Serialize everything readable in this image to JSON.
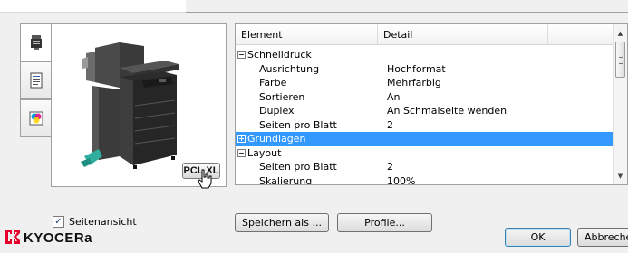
{
  "tabs": [
    {
      "name": "printer-tab",
      "icon": "printer-icon",
      "active": true
    },
    {
      "name": "document-tab",
      "icon": "document-icon",
      "active": false
    },
    {
      "name": "color-tab",
      "icon": "color-quality-icon",
      "active": false
    }
  ],
  "preview": {
    "pdl_badge": "PCL XL",
    "show_preview_label": "Seitenansicht",
    "show_preview_checked": true
  },
  "table": {
    "headers": [
      "Element",
      "Detail",
      ""
    ],
    "rows": [
      {
        "label": "Schnelldruck",
        "value": "",
        "level": 0,
        "toggle": "minus",
        "selected": false
      },
      {
        "label": "Ausrichtung",
        "value": "Hochformat",
        "level": 1,
        "toggle": "",
        "selected": false
      },
      {
        "label": "Farbe",
        "value": "Mehrfarbig",
        "level": 1,
        "toggle": "",
        "selected": false
      },
      {
        "label": "Sortieren",
        "value": "An",
        "level": 1,
        "toggle": "",
        "selected": false
      },
      {
        "label": "Duplex",
        "value": "An Schmalseite wenden",
        "level": 1,
        "toggle": "",
        "selected": false
      },
      {
        "label": "Seiten pro Blatt",
        "value": "2",
        "level": 1,
        "toggle": "",
        "selected": false
      },
      {
        "label": "Grundlagen",
        "value": "",
        "level": 0,
        "toggle": "plus",
        "selected": true
      },
      {
        "label": "Layout",
        "value": "",
        "level": 0,
        "toggle": "minus",
        "selected": false
      },
      {
        "label": "Seiten pro Blatt",
        "value": "2",
        "level": 1,
        "toggle": "",
        "selected": false
      },
      {
        "label": "Skalierung",
        "value": "100%",
        "level": 1,
        "toggle": "",
        "selected": false
      }
    ]
  },
  "buttons": {
    "save_as": "Speichern als ...",
    "profiles": "Profile...",
    "ok": "OK",
    "cancel": "Abbrechen"
  },
  "brand": {
    "name": "KYOCERa",
    "logo_color": "#e4002b"
  },
  "colors": {
    "selection": "#3399ff",
    "window_bg": "#f0f0f0"
  }
}
